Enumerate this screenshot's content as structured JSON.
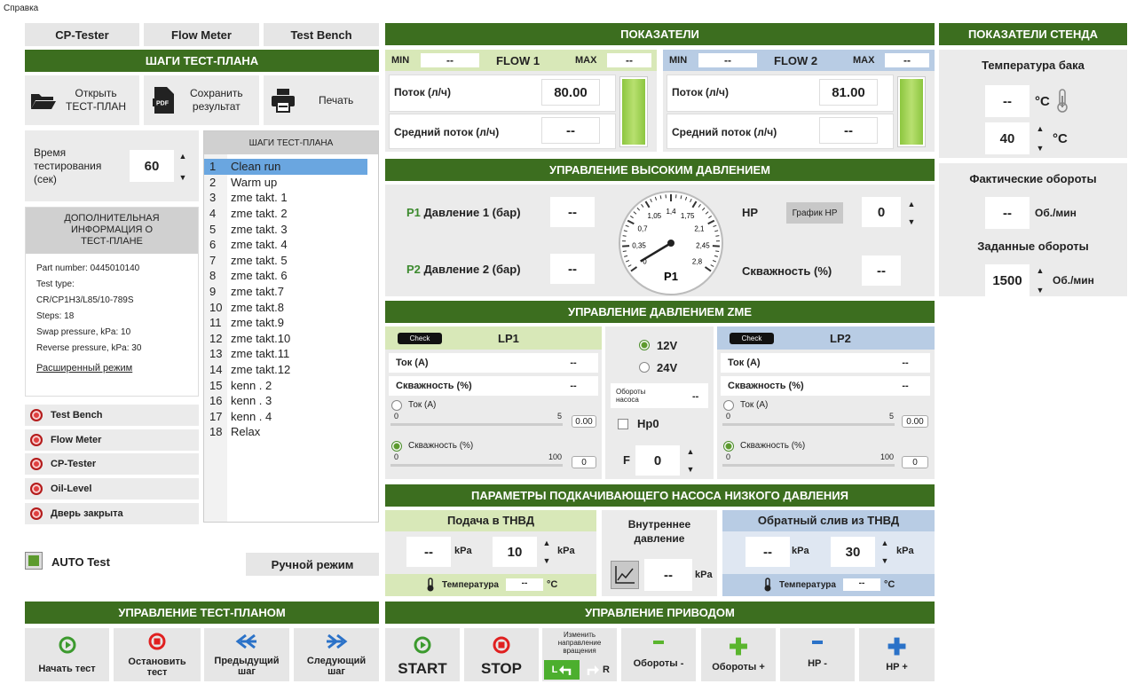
{
  "window_title": "Справка",
  "top_tabs": [
    "CP-Tester",
    "Flow Meter",
    "Test Bench"
  ],
  "steps_header": "ШАГИ ТЕСТ-ПЛАНА",
  "open_label": "Открыть\nТЕСТ-ПЛАН",
  "save_label": "Сохранить\nрезультат",
  "print_label": "Печать",
  "test_time_label": "Время\nтестирования\n(сек)",
  "test_time_value": "60",
  "steps_list_header": "ШАГИ ТЕСТ-ПЛАНА",
  "steps": [
    {
      "n": "1",
      "name": "Clean run"
    },
    {
      "n": "2",
      "name": "Warm up"
    },
    {
      "n": "3",
      "name": "zme takt. 1"
    },
    {
      "n": "4",
      "name": "zme takt. 2"
    },
    {
      "n": "5",
      "name": "zme takt. 3"
    },
    {
      "n": "6",
      "name": "zme takt. 4"
    },
    {
      "n": "7",
      "name": "zme takt. 5"
    },
    {
      "n": "8",
      "name": "zme takt. 6"
    },
    {
      "n": "9",
      "name": "zme takt.7"
    },
    {
      "n": "10",
      "name": "zme takt.8"
    },
    {
      "n": "11",
      "name": "zme takt.9"
    },
    {
      "n": "12",
      "name": "zme takt.10"
    },
    {
      "n": "13",
      "name": "zme takt.11"
    },
    {
      "n": "14",
      "name": "zme takt.12"
    },
    {
      "n": "15",
      "name": "kenn . 2"
    },
    {
      "n": "16",
      "name": "kenn . 3"
    },
    {
      "n": "17",
      "name": "kenn . 4"
    },
    {
      "n": "18",
      "name": "Relax"
    }
  ],
  "add_info_header": "ДОПОЛНИТЕЛЬНАЯ\nИНФОРМАЦИЯ О\nТЕСТ-ПЛАНЕ",
  "info": {
    "part": "Part number:  0445010140",
    "type_label": "Test type:",
    "type": "CR/CP1H3/L85/10-789S",
    "steps": "Steps:  18",
    "swap": "Swap pressure, kPa:  10",
    "reverse": "Reverse pressure, kPa:  30",
    "advanced": "Расширенный режим"
  },
  "status_items": [
    "Test Bench",
    "Flow Meter",
    "CP-Tester",
    "Oil-Level",
    "Дверь закрыта"
  ],
  "auto_test": "AUTO Test",
  "manual_mode": "Ручной режим",
  "plan_ctrl_header": "УПРАВЛЕНИЕ ТЕСТ-ПЛАНОМ",
  "plan_buttons": [
    "Начать тест",
    "Остановить\nтест",
    "Предыдущий\nшаг",
    "Следующий\nшаг"
  ],
  "indicators_header": "ПОКАЗАТЕЛИ",
  "flow1": {
    "min": "MIN",
    "min_v": "--",
    "title": "FLOW 1",
    "max": "MAX",
    "max_v": "--",
    "flow_label": "Поток (л/ч)",
    "flow_v": "80.00",
    "avg_label": "Средний поток (л/ч)",
    "avg_v": "--"
  },
  "flow2": {
    "min": "MIN",
    "min_v": "--",
    "title": "FLOW 2",
    "max": "MAX",
    "max_v": "--",
    "flow_label": "Поток (л/ч)",
    "flow_v": "81.00",
    "avg_label": "Средний поток (л/ч)",
    "avg_v": "--"
  },
  "hp_header": "УПРАВЛЕНИЕ ВЫСОКИМ ДАВЛЕНИЕМ",
  "hp": {
    "p1_pre": "P1",
    "p1_label": " Давление 1 (бар)",
    "p1_v": "--",
    "p2_pre": "P2",
    "p2_label": " Давление 2 (бар)",
    "p2_v": "--",
    "gauge_ticks": [
      "0",
      "0,35",
      "0,7",
      "1,05",
      "1,4",
      "1,75",
      "2,1",
      "2,45",
      "2,8"
    ],
    "gauge_label": "P1",
    "hp_label": "HP",
    "graph_btn": "График HP",
    "hp_v": "0",
    "duty_label": "Скважность (%)",
    "duty_v": "--"
  },
  "zme_header": "УПРАВЛЕНИЕ ДАВЛЕНИЕМ ZME",
  "lp1": {
    "check": "Check",
    "title": "LP1",
    "cur": "Ток (А)",
    "cur_v": "--",
    "duty": "Скважность (%)",
    "duty_v": "--",
    "r1": "Ток (А)",
    "r1_min": "0",
    "r1_max": "5",
    "r1_v": "0.00",
    "r2": "Скважность (%)",
    "r2_min": "0",
    "r2_max": "100",
    "r2_v": "0"
  },
  "lp2": {
    "check": "Check",
    "title": "LP2",
    "cur": "Ток (А)",
    "cur_v": "--",
    "duty": "Скважность (%)",
    "duty_v": "--",
    "r1": "Ток (А)",
    "r1_min": "0",
    "r1_max": "5",
    "r1_v": "0.00",
    "r2": "Скважность (%)",
    "r2_min": "0",
    "r2_max": "100",
    "r2_v": "0"
  },
  "mid": {
    "v12": "12V",
    "v24": "24V",
    "pump_rpm": "Обороты\nнасоса",
    "pump_v": "--",
    "hp0": "Hp0",
    "f_label": "F",
    "f_v": "0"
  },
  "lowpump_header": "ПАРАМЕТРЫ ПОДКАЧИВАЮЩЕГО НАСОСА НИЗКОГО ДАВЛЕНИЯ",
  "feed": {
    "title": "Подача в ТНВД",
    "v1": "--",
    "u1": "kPa",
    "v2": "10",
    "u2": "kPa",
    "temp_label": "Температура",
    "temp_v": "--",
    "temp_u": "°C"
  },
  "inner": {
    "title": "Внутреннее\nдавление",
    "v": "--",
    "u": "kPa"
  },
  "ret": {
    "title": "Обратный слив из ТНВД",
    "v1": "--",
    "u1": "kPa",
    "v2": "30",
    "u2": "kPa",
    "temp_label": "Температура",
    "temp_v": "--",
    "temp_u": "°C"
  },
  "drive_header": "УПРАВЛЕНИЕ ПРИВОДОМ",
  "drive": {
    "start": "START",
    "stop": "STOP",
    "dir_label": "Изменить\nнаправление\nвращения",
    "dir_l": "L",
    "dir_r": "R",
    "rpm_minus": "Обороты -",
    "rpm_plus": "Обороты +",
    "hp_minus": "HP -",
    "hp_plus": "HP +"
  },
  "stand_header": "ПОКАЗАТЕЛИ СТЕНДА",
  "stand": {
    "tank_label": "Температура бака",
    "tank_v": "--",
    "tank_u": "°C",
    "set_v": "40",
    "set_u": "°C",
    "actual_label": "Фактические обороты",
    "actual_v": "--",
    "actual_u": "Об./мин",
    "target_label": "Заданные обороты",
    "target_v": "1500",
    "target_u": "Об./мин"
  },
  "colors": {
    "header_green": "#3c6e1f",
    "lp1_bg": "#d8e8b8",
    "lp2_bg": "#b8cce4",
    "accent_red": "#e04040",
    "selection": "#6aa6e0"
  }
}
